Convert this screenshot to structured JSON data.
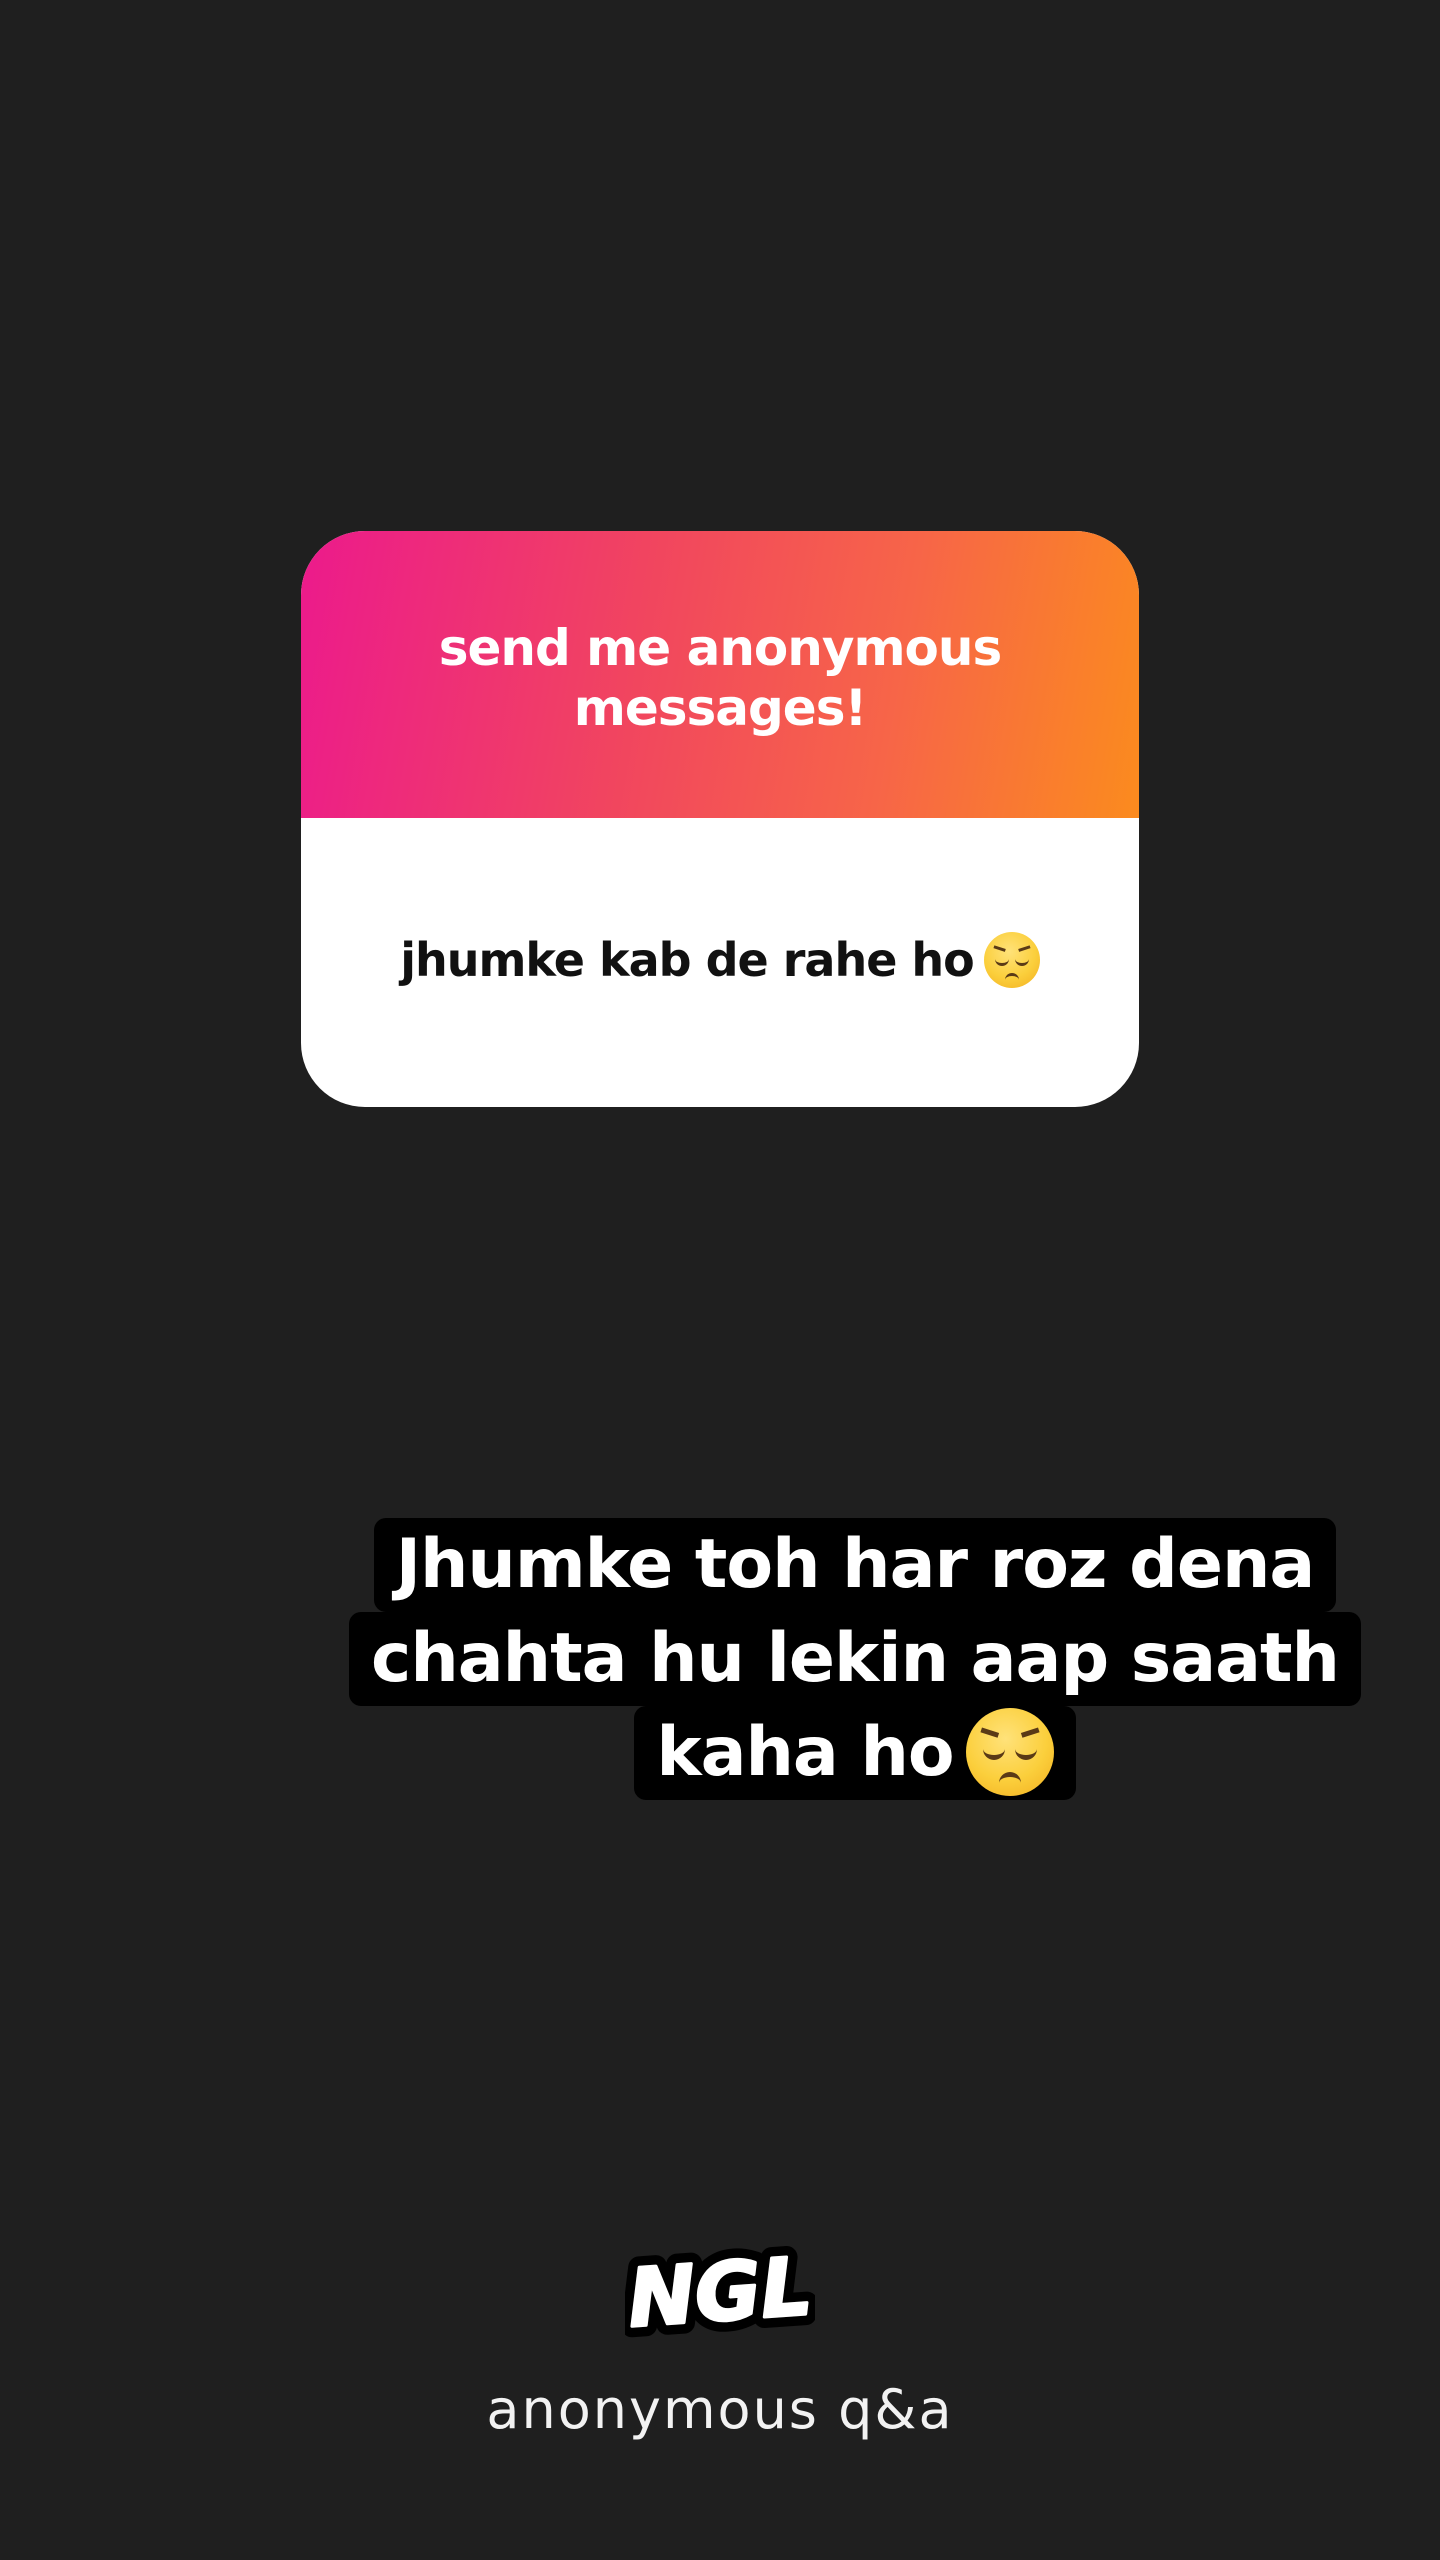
{
  "card": {
    "title": "send me anonymous messages!",
    "question": "jhumke kab de rahe ho",
    "question_emoji": "pensive-face",
    "gradient_colors": [
      "#ec1a8c",
      "#fb8b1e"
    ]
  },
  "reply": {
    "lines": [
      "Jhumke toh har roz dena",
      "chahta hu lekin aap saath",
      "kaha ho"
    ],
    "emoji": "pensive-face"
  },
  "footer": {
    "logo_text": "NGL",
    "subtitle": "anonymous q&a"
  },
  "colors": {
    "background": "#1f1f1f",
    "reply_background": "#000000",
    "text_light": "#ffffff"
  }
}
